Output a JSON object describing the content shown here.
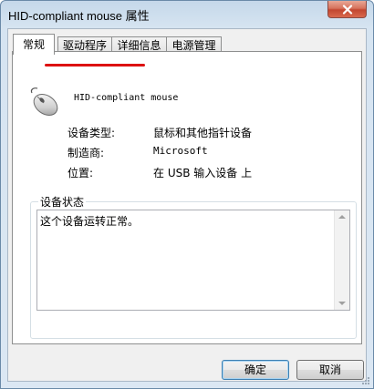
{
  "window": {
    "title": "HID-compliant mouse 属性"
  },
  "tabs": [
    {
      "label": "常规",
      "active": true
    },
    {
      "label": "驱动程序",
      "active": false
    },
    {
      "label": "详细信息",
      "active": false
    },
    {
      "label": "电源管理",
      "active": false
    }
  ],
  "device": {
    "name": "HID-compliant mouse",
    "icon": "mouse-icon"
  },
  "properties": [
    {
      "label": "设备类型:",
      "value": "鼠标和其他指针设备"
    },
    {
      "label": "制造商:",
      "value": "Microsoft"
    },
    {
      "label": "位置:",
      "value": "在 USB 输入设备 上"
    }
  ],
  "status": {
    "legend": "设备状态",
    "text": "这个设备运转正常。"
  },
  "buttons": {
    "ok": "确定",
    "cancel": "取消"
  },
  "colors": {
    "annotation": "#dd1111",
    "default_button_border": "#3c7fb1"
  }
}
